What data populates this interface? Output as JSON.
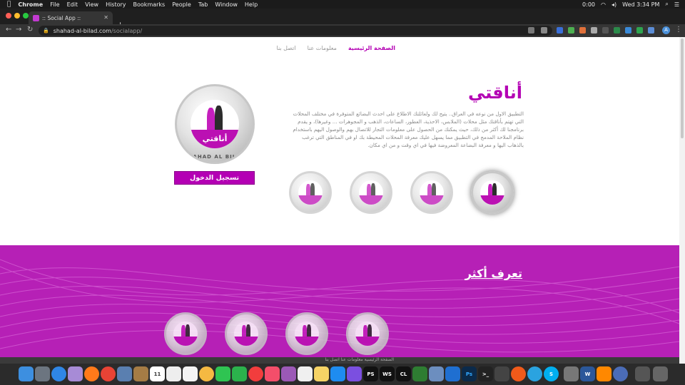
{
  "menubar": {
    "app_name": "Chrome",
    "items": [
      "File",
      "Edit",
      "View",
      "History",
      "Bookmarks",
      "People",
      "Tab",
      "Window",
      "Help"
    ],
    "battery_text": "0:00",
    "clock": "Wed 3:34 PM"
  },
  "browser": {
    "tab_title": ":: Social App ::",
    "url_host": "shahad-al-bilad.com",
    "url_path": "/socialapp/",
    "profile_letter": "A"
  },
  "page": {
    "nav": {
      "home": "الصفحة الرئيسية",
      "about": "معلومات عنا",
      "contact": "اتصل بنا"
    },
    "title": "أناقتي",
    "description": "التطبيق الاول من نوعه في العراق.. يتيح لك ولعائلتك الاطلاع على احدث البضائع المتوفرة في مختلف المحلات التي تهتم بأناقتك مثل محلات (الملابس، الاحذية، العطور، الساعات، الذهب و المجوهرات ... وغيرها)، و يقدم برنامجنا لك أكثر من ذلك، حيث يمكنك من الحصول على معلومات التجار للاتصال بهم والوصول اليهم باستخدام نظام الملاحة المدمج في التطبيق مما يسهل عليك معرفة المحلات المحيطة بك او في المناطق التي ترغب بالذهاب اليها و معرفة البضاعة المعروضة فيها في اي وقت و من اي مكان.",
    "logo_caption": "أناقتي",
    "logo_ring_text": "SHAHAD AL BILAD",
    "login_button": "تسجيل الدخول",
    "learn_more": "تعرف أكثر",
    "footer_links": "الصفحة الرئيسية   معلومات عنا   اتصل بنا"
  },
  "colors": {
    "brand": "#b400b4",
    "band": "#b620b6",
    "menubar": "#1b1b1b"
  },
  "dock": {
    "calendar_day": "11",
    "icons": [
      "finder-icon",
      "launchpad-icon",
      "safari-icon",
      "firefox-icon",
      "chrome-icon",
      "preview-icon",
      "notes-icon",
      "calendar-icon",
      "reminders-icon",
      "photos-icon",
      "facetime-icon",
      "news-icon",
      "music-icon",
      "app-store-icon",
      "terminal-icon",
      "photoshop-icon",
      "webstorm-icon",
      "clion-icon",
      "vscode-icon",
      "telegram-icon",
      "skype-icon",
      "word-icon",
      "vlc-icon",
      "trash-icon"
    ]
  }
}
